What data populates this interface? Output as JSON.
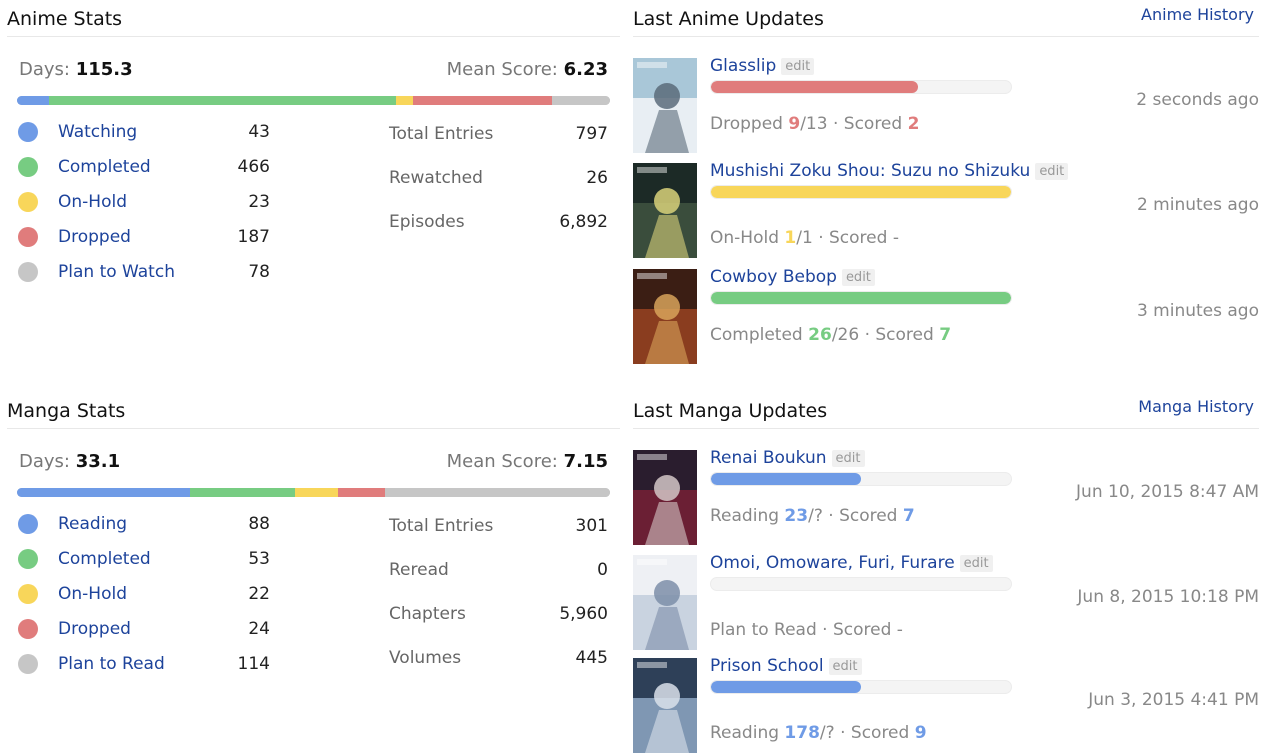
{
  "colors": {
    "watching": "#6f9be6",
    "completed": "#77cc82",
    "on_hold": "#f8d65a",
    "dropped": "#e07c7c",
    "plan": "#c6c6c6"
  },
  "anime_stats": {
    "title": "Anime Stats",
    "days_label": "Days:",
    "days": "115.3",
    "mean_label": "Mean Score:",
    "mean": "6.23",
    "statuses": [
      {
        "label": "Watching",
        "count": "43",
        "color": "#6f9be6"
      },
      {
        "label": "Completed",
        "count": "466",
        "color": "#77cc82"
      },
      {
        "label": "On-Hold",
        "count": "23",
        "color": "#f8d65a"
      },
      {
        "label": "Dropped",
        "count": "187",
        "color": "#e07c7c"
      },
      {
        "label": "Plan to Watch",
        "count": "78",
        "color": "#c6c6c6"
      }
    ],
    "totals": [
      {
        "label": "Total Entries",
        "value": "797"
      },
      {
        "label": "Rewatched",
        "value": "26"
      },
      {
        "label": "Episodes",
        "value": "6,892"
      }
    ]
  },
  "manga_stats": {
    "title": "Manga Stats",
    "days_label": "Days:",
    "days": "33.1",
    "mean_label": "Mean Score:",
    "mean": "7.15",
    "statuses": [
      {
        "label": "Reading",
        "count": "88",
        "color": "#6f9be6"
      },
      {
        "label": "Completed",
        "count": "53",
        "color": "#77cc82"
      },
      {
        "label": "On-Hold",
        "count": "22",
        "color": "#f8d65a"
      },
      {
        "label": "Dropped",
        "count": "24",
        "color": "#e07c7c"
      },
      {
        "label": "Plan to Read",
        "count": "114",
        "color": "#c6c6c6"
      }
    ],
    "totals": [
      {
        "label": "Total Entries",
        "value": "301"
      },
      {
        "label": "Reread",
        "value": "0"
      },
      {
        "label": "Chapters",
        "value": "5,960"
      },
      {
        "label": "Volumes",
        "value": "445"
      }
    ]
  },
  "anime_updates": {
    "title": "Last Anime Updates",
    "history_link": "Anime History",
    "items": [
      {
        "title": "Glasslip",
        "edit": "edit",
        "status": "Dropped",
        "progress": "9",
        "total": "/13",
        "score_label": "· Scored",
        "score": "2",
        "accent": "#e07c7c",
        "fill": 0.69,
        "time": "2 seconds ago"
      },
      {
        "title": "Mushishi Zoku Shou: Suzu no Shizuku",
        "edit": "edit",
        "status": "On-Hold",
        "progress": "1",
        "total": "/1",
        "score_label": "· Scored",
        "score": "-",
        "accent": "#f8d65a",
        "fill": 1.0,
        "time": "2 minutes ago"
      },
      {
        "title": "Cowboy Bebop",
        "edit": "edit",
        "status": "Completed",
        "progress": "26",
        "total": "/26",
        "score_label": "· Scored",
        "score": "7",
        "accent": "#77cc82",
        "fill": 1.0,
        "time": "3 minutes ago"
      }
    ]
  },
  "manga_updates": {
    "title": "Last Manga Updates",
    "history_link": "Manga History",
    "items": [
      {
        "title": "Renai Boukun",
        "edit": "edit",
        "status": "Reading",
        "progress": "23",
        "total": "/?",
        "score_label": "· Scored",
        "score": "7",
        "accent": "#6f9be6",
        "fill": 0.5,
        "time": "Jun 10, 2015 8:47 AM"
      },
      {
        "title": "Omoi, Omoware, Furi, Furare",
        "edit": "edit",
        "status": "Plan to Read",
        "progress": "",
        "total": "",
        "score_label": "· Scored",
        "score": "-",
        "accent": "#6f9be6",
        "fill": 0.0,
        "time": "Jun 8, 2015 10:18 PM"
      },
      {
        "title": "Prison School",
        "edit": "edit",
        "status": "Reading",
        "progress": "178",
        "total": "/?",
        "score_label": "· Scored",
        "score": "9",
        "accent": "#6f9be6",
        "fill": 0.5,
        "time": "Jun 3, 2015 4:41 PM"
      }
    ]
  }
}
